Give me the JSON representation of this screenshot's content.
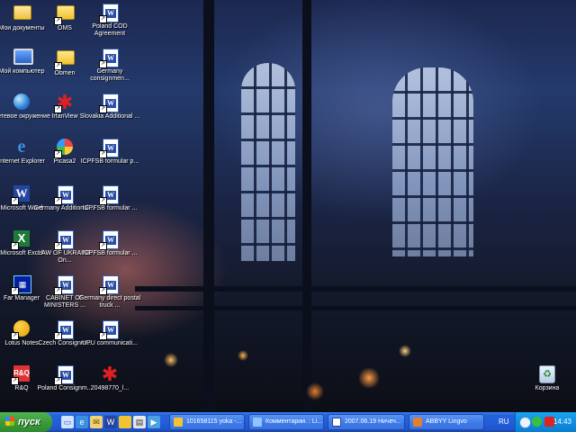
{
  "desktop": {
    "icons": [
      {
        "label": "Мои документы",
        "icon": "my-documents-icon"
      },
      {
        "label": "OMS",
        "icon": "folder-icon"
      },
      {
        "label": "Poland COD Agreement",
        "icon": "word-document-icon"
      },
      {
        "label": "Мой компьютер",
        "icon": "my-computer-icon"
      },
      {
        "label": "Obmen",
        "icon": "folder-icon"
      },
      {
        "label": "Germany consignmen...",
        "icon": "word-document-icon"
      },
      {
        "label": "Сетевое окружение",
        "icon": "network-icon"
      },
      {
        "label": "IrfanView",
        "icon": "irfanview-icon"
      },
      {
        "label": "Slovakia Additional ...",
        "icon": "word-document-icon"
      },
      {
        "label": "Internet Explorer",
        "icon": "internet-explorer-icon"
      },
      {
        "label": "Picasa2",
        "icon": "picasa-icon"
      },
      {
        "label": "ICPFSB formular p...",
        "icon": "word-document-icon"
      },
      {
        "label": "Microsoft Word",
        "icon": "word-app-icon"
      },
      {
        "label": "Germany Additional ...",
        "icon": "word-document-icon"
      },
      {
        "label": "ICPFSB formular ...",
        "icon": "word-document-icon"
      },
      {
        "label": "Microsoft Excel",
        "icon": "excel-app-icon"
      },
      {
        "label": "LAW OF UKRAINE On...",
        "icon": "word-document-icon"
      },
      {
        "label": "ICPFSB formular ...",
        "icon": "word-document-icon"
      },
      {
        "label": "Far Manager",
        "icon": "far-manager-icon"
      },
      {
        "label": "CABINET OF MINISTERS ...",
        "icon": "word-document-icon"
      },
      {
        "label": "Germany direct postal truck ...",
        "icon": "word-document-icon"
      },
      {
        "label": "Lotus Notes",
        "icon": "lotus-notes-icon"
      },
      {
        "label": "Czech Consignm...",
        "icon": "word-document-icon"
      },
      {
        "label": "UPU communicati...",
        "icon": "word-document-icon"
      },
      {
        "label": "R&Q",
        "icon": "rq-icon"
      },
      {
        "label": "Poland Consignm...",
        "icon": "word-document-icon"
      },
      {
        "label": "20498770_l...",
        "icon": "irfanview-icon"
      },
      {
        "label": "Корзина",
        "icon": "recycle-bin-icon"
      }
    ]
  },
  "taskbar": {
    "start_label": "пуск",
    "quick_launch": [
      "show-desktop-icon",
      "ie-icon",
      "outlook-icon",
      "word-icon",
      "folder-icon",
      "notes-icon",
      "media-icon"
    ],
    "tasks": [
      {
        "label": "101658115 yoka -...",
        "icon": "folder-icon"
      },
      {
        "label": "Комментарии. : Li...",
        "icon": "browser-icon"
      },
      {
        "label": "2007.06.19 Ничеч...",
        "icon": "word-icon"
      },
      {
        "label": "ABBYY Lingvo",
        "icon": "lingvo-icon"
      }
    ],
    "language": "RU",
    "clock": "14:43",
    "tray_icons": [
      "network-tray-icon",
      "security-tray-icon",
      "antivirus-tray-icon"
    ]
  },
  "colors": {
    "taskbar_blue": "#245edb",
    "start_green": "#3c9a3c",
    "tray_blue": "#0f8fe0"
  }
}
